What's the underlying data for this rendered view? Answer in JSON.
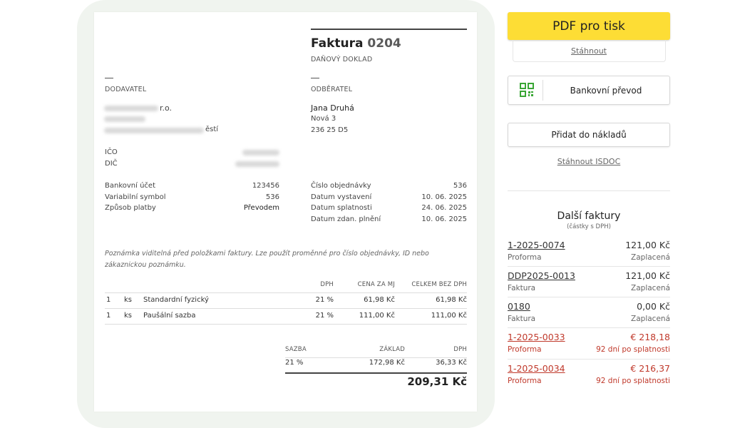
{
  "invoice": {
    "title_prefix": "Faktura",
    "number": "0204",
    "doc_type": "DAŇOVÝ DOKLAD",
    "supplier_label": "DODAVATEL",
    "supplier_name_suffix": "r.o.",
    "supplier_city_suffix": "ěstí",
    "customer_label": "ODBĚRATEL",
    "customer_name": "Jana Druhá",
    "customer_street": "Nová 3",
    "customer_zip_city": "236 25 D5",
    "ico_label": "IČO",
    "dic_label": "DIČ",
    "left_details": [
      {
        "label": "Bankovní účet",
        "value": "123456"
      },
      {
        "label": "Variabilní symbol",
        "value": "536"
      },
      {
        "label": "Způsob platby",
        "value": "Převodem"
      }
    ],
    "right_details": [
      {
        "label": "Číslo objednávky",
        "value": "536"
      },
      {
        "label": "Datum vystavení",
        "value": "10. 06. 2025"
      },
      {
        "label": "Datum splatnosti",
        "value": "24. 06. 2025"
      },
      {
        "label": "Datum zdan. plnění",
        "value": "10. 06. 2025"
      }
    ],
    "note": "Poznámka viditelná před položkami faktury. Lze použít proměnné pro číslo objednávky, ID nebo zákaznickou poznámku.",
    "items_headers": {
      "vat": "DPH",
      "unit_price": "CENA ZA MJ",
      "total": "CELKEM BEZ DPH"
    },
    "items": [
      {
        "qty": "1",
        "unit": "ks",
        "name": "Standardní fyzický",
        "vat": "21 %",
        "unit_price": "61,98 Kč",
        "total": "61,98 Kč"
      },
      {
        "qty": "1",
        "unit": "ks",
        "name": "Paušální sazba",
        "vat": "21 %",
        "unit_price": "111,00 Kč",
        "total": "111,00 Kč"
      }
    ],
    "summary_headers": {
      "rate": "SAZBA",
      "base": "ZÁKLAD",
      "vat": "DPH"
    },
    "summary_row": {
      "rate": "21 %",
      "base": "172,98 Kč",
      "vat": "36,33 Kč"
    },
    "grand_total": "209,31 Kč"
  },
  "sidebar": {
    "pdf_button": "PDF pro tisk",
    "download_link": "Stáhnout",
    "bank_transfer_button": "Bankovní převod",
    "add_costs_button": "Přidat do nákladů",
    "isdoc_link": "Stáhnout ISDOC",
    "other_invoices_title": "Další faktury",
    "other_invoices_subtitle": "(částky s DPH)",
    "other_invoices": [
      {
        "number": "1-2025-0074",
        "amount": "121,00 Kč",
        "type": "Proforma",
        "status": "Zaplacená",
        "overdue": false
      },
      {
        "number": "DDP2025-0013",
        "amount": "121,00 Kč",
        "type": "Faktura",
        "status": "Zaplacená",
        "overdue": false
      },
      {
        "number": "0180",
        "amount": "0,00 Kč",
        "type": "Faktura",
        "status": "Zaplacená",
        "overdue": false
      },
      {
        "number": "1-2025-0033",
        "amount": "€ 218,18",
        "type": "Proforma",
        "status": "92 dní po splatnosti",
        "overdue": true
      },
      {
        "number": "1-2025-0034",
        "amount": "€ 216,37",
        "type": "Proforma",
        "status": "92 dní po splatnosti",
        "overdue": true
      }
    ]
  },
  "colors": {
    "accent_yellow": "#fddd35",
    "overdue_red": "#c0392b",
    "qr_icon_green": "#3aa635"
  }
}
